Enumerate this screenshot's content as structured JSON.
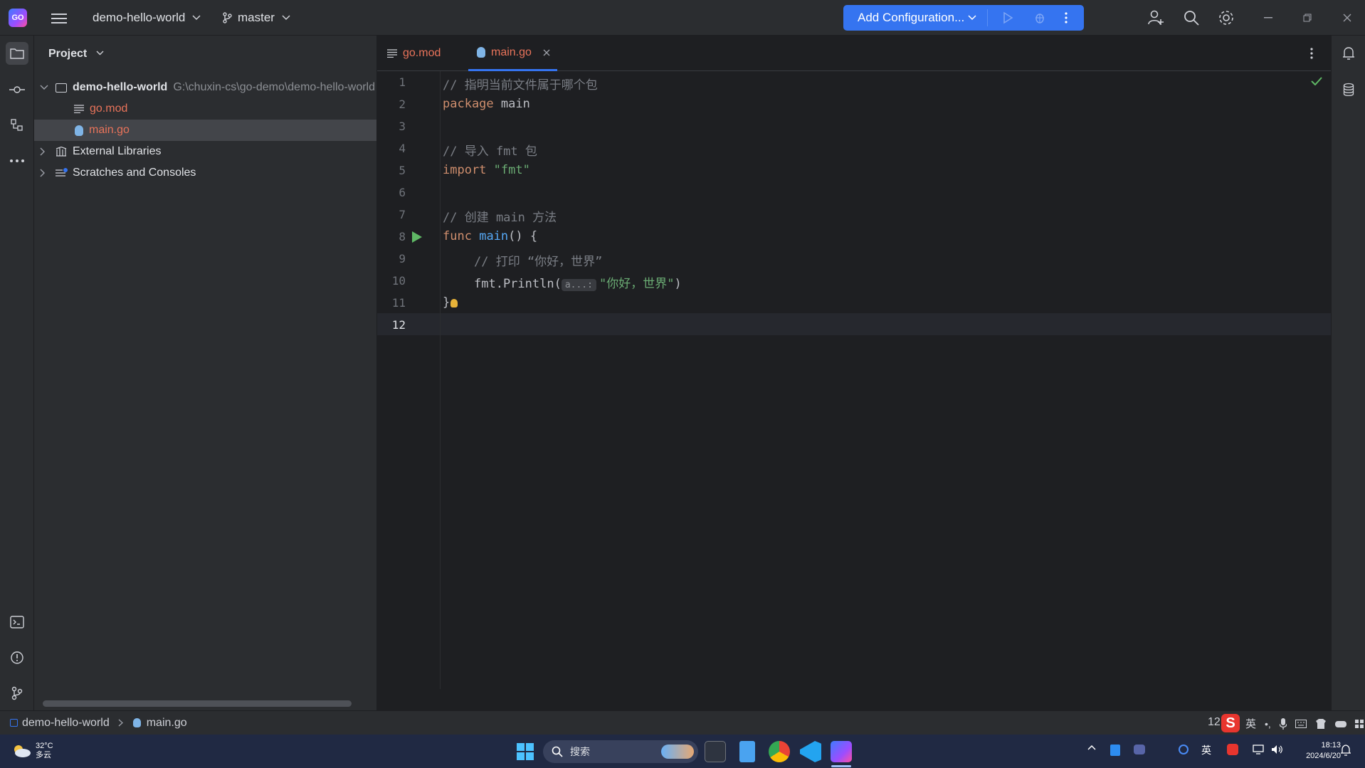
{
  "titlebar": {
    "logo_text": "GO",
    "project_name": "demo-hello-world",
    "branch": "master",
    "add_configuration": "Add Configuration..."
  },
  "project_panel": {
    "title": "Project",
    "tree": {
      "root_name": "demo-hello-world",
      "root_path": "G:\\chuxin-cs\\go-demo\\demo-hello-world",
      "file1": "go.mod",
      "file2": "main.go",
      "external": "External Libraries",
      "scratches": "Scratches and Consoles"
    }
  },
  "editor": {
    "tabs": [
      {
        "label": "go.mod"
      },
      {
        "label": "main.go"
      }
    ],
    "line_numbers": [
      "1",
      "2",
      "3",
      "4",
      "5",
      "6",
      "7",
      "8",
      "9",
      "10",
      "11",
      "12"
    ],
    "code": {
      "l1": "// 指明当前文件属于哪个包",
      "l2_kw": "package",
      "l2_rest": " main",
      "l4": "// 导入 fmt 包",
      "l5_kw": "import",
      "l5_str": "\"fmt\"",
      "l7": "// 创建 main 方法",
      "l8_kw": "func",
      "l8_fn": "main",
      "l8_rest": "() {",
      "l9": "// 打印 “你好，世界”",
      "l10_call": "fmt.Println(",
      "l10_hint": "a...:",
      "l10_str": "\"你好，世界\"",
      "l10_end": ")",
      "l11": "}"
    }
  },
  "statusbar": {
    "crumb_project": "demo-hello-world",
    "crumb_file": "main.go",
    "position": "12"
  },
  "taskbar": {
    "weather_temp": "32°C",
    "weather_desc": "多云",
    "search_label": "搜索",
    "ime": "英",
    "time": "18:13",
    "date": "2024/6/20"
  },
  "colors": {
    "accent": "#3574f0",
    "keyword": "#cf8e6d",
    "string": "#6aab73",
    "comment": "#7a7e85",
    "modified_file": "#e8735a"
  }
}
